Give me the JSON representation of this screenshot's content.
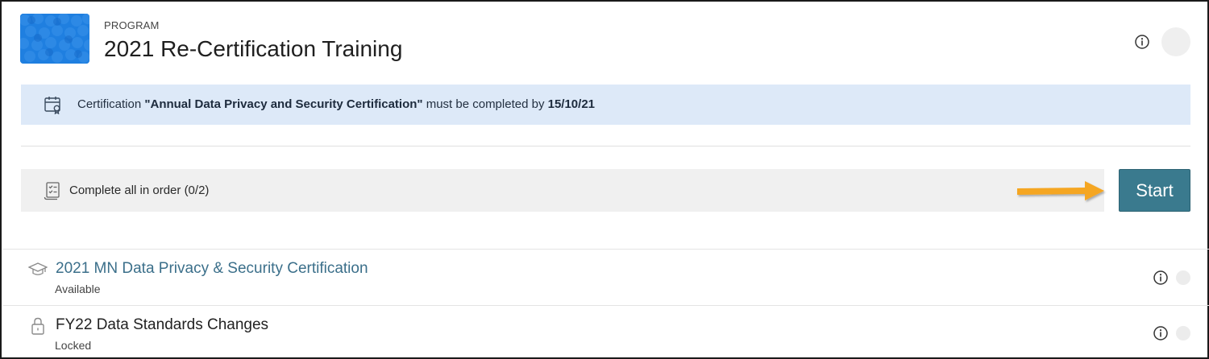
{
  "header": {
    "eyebrow": "PROGRAM",
    "title": "2021 Re-Certification Training",
    "thumbnail_color": "#1f7fe0"
  },
  "banner": {
    "prefix": "Certification ",
    "certification_name": "\"Annual Data Privacy and Security Certification\"",
    "middle": " must be completed by ",
    "due_date": "15/10/21",
    "background": "#dde9f8"
  },
  "order": {
    "label": "Complete all in order (0/2)"
  },
  "start_button": {
    "label": "Start",
    "color": "#3a7a8e"
  },
  "annotation": {
    "arrow_color": "#f5a623"
  },
  "items": [
    {
      "title": "2021 MN Data Privacy & Security Certification",
      "status": "Available",
      "icon": "graduation-cap-icon"
    },
    {
      "title": "FY22 Data Standards Changes",
      "status": "Locked",
      "icon": "lock-icon"
    }
  ]
}
